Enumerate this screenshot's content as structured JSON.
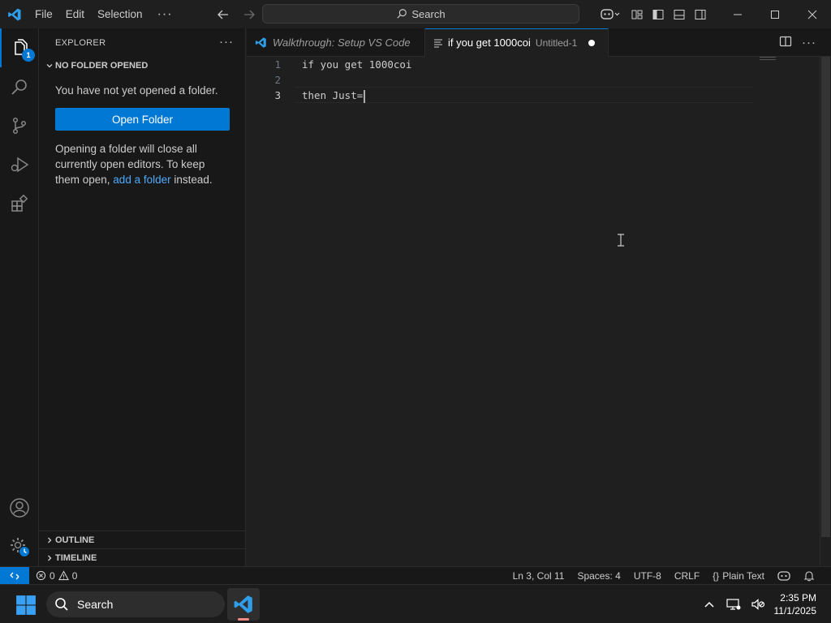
{
  "app": {
    "accent_color": "#0078d4",
    "menu": [
      "File",
      "Edit",
      "Selection"
    ],
    "search_placeholder": "Search"
  },
  "sidebar": {
    "title": "EXPLORER",
    "section_title": "NO FOLDER OPENED",
    "empty_message": "You have not yet opened a folder.",
    "open_folder_label": "Open Folder",
    "info_before_link": "Opening a folder will close all currently open editors. To keep them open, ",
    "info_link": "add a folder",
    "info_after_link": " instead.",
    "outline_label": "OUTLINE",
    "timeline_label": "TIMELINE",
    "explorer_badge": "1"
  },
  "tabs": [
    {
      "label": "Walkthrough: Setup VS Code",
      "description": ""
    },
    {
      "label": "if you get 1000coi",
      "description": "Untitled-1"
    }
  ],
  "editor": {
    "lines": [
      {
        "number": "1",
        "text": "if you get 1000coi"
      },
      {
        "number": "2",
        "text": ""
      },
      {
        "number": "3",
        "text": "then Just="
      }
    ]
  },
  "statusbar": {
    "errors": "0",
    "warnings": "0",
    "position": "Ln 3, Col 11",
    "spaces": "Spaces: 4",
    "encoding": "UTF-8",
    "eol": "CRLF",
    "language": "Plain Text"
  },
  "taskbar": {
    "search_label": "Search",
    "time": "2:35 PM",
    "date": "11/1/2025"
  }
}
